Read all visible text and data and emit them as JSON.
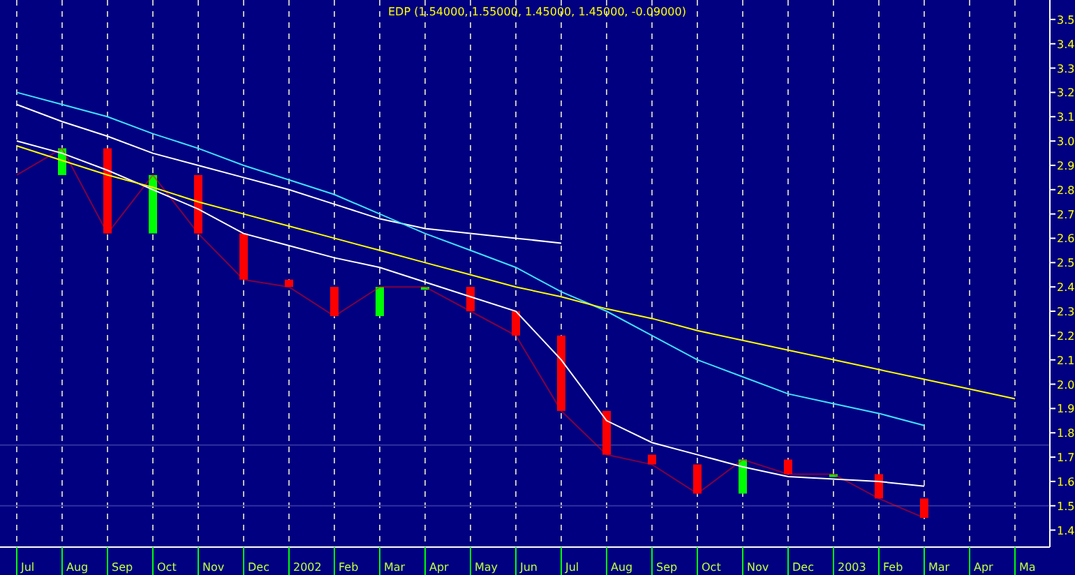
{
  "chart": {
    "chart_data": {
      "type": "line",
      "title": "EDP (1.54000, 1.55000, 1.45000, 1.45000, -0.09000)",
      "categories": [
        "Jul",
        "Aug",
        "Sep",
        "Oct",
        "Nov",
        "Dec",
        "2002",
        "Feb",
        "Mar",
        "Apr",
        "May",
        "Jun",
        "Jul",
        "Aug",
        "Sep",
        "Oct",
        "Nov",
        "Dec",
        "2003",
        "Feb",
        "Mar",
        "Apr",
        "Ma"
      ],
      "ylim": [
        1.33,
        3.58
      ],
      "ref_lines": [
        {
          "axis": "y",
          "value": 1.5
        },
        {
          "axis": "y",
          "value": 1.75
        }
      ],
      "yticks": [
        1.4,
        1.5,
        1.6,
        1.7,
        1.8,
        1.9,
        {
          "value": 2,
          "label": "2.0"
        },
        2.1,
        2.2,
        2.3,
        2.4,
        2.5,
        2.6,
        2.7,
        2.8,
        2.9,
        {
          "value": 3,
          "label": "3.0"
        },
        3.1,
        3.2,
        3.3,
        3.4,
        3.5
      ],
      "series": [
        {
          "color": "#ff0000",
          "values": [
            2.86,
            2.97,
            2.62,
            2.86,
            2.62,
            2.43,
            2.4,
            2.28,
            2.4,
            2.4,
            2.3,
            2.2,
            1.89,
            1.71,
            1.67,
            1.55,
            1.69,
            1.63,
            1.63,
            1.53,
            1.45,
            null,
            null
          ]
        },
        {
          "color": "#ffffff",
          "values": [
            3.0,
            2.95,
            2.88,
            2.8,
            2.72,
            2.62,
            2.57,
            2.52,
            2.48,
            2.42,
            2.36,
            2.3,
            2.1,
            1.85,
            1.76,
            1.71,
            1.66,
            1.62,
            1.61,
            1.6,
            1.58,
            null,
            null
          ]
        },
        {
          "color": "#ffffff",
          "values": [
            3.15,
            3.08,
            3.02,
            2.95,
            2.9,
            2.85,
            2.8,
            2.74,
            2.68,
            2.64,
            2.62,
            2.6,
            2.58,
            null,
            null,
            null,
            null,
            null,
            null,
            null,
            null,
            null,
            null
          ]
        },
        {
          "color": "#40e0ff",
          "values": [
            3.2,
            3.15,
            3.1,
            3.03,
            2.97,
            2.9,
            2.84,
            2.78,
            2.7,
            2.62,
            2.55,
            2.48,
            2.38,
            2.3,
            2.2,
            2.1,
            2.03,
            1.96,
            1.92,
            1.88,
            1.83,
            null,
            null
          ]
        },
        {
          "color": "#ffff00",
          "values": [
            2.98,
            2.92,
            2.86,
            2.81,
            2.75,
            2.7,
            2.65,
            2.6,
            2.55,
            2.5,
            2.45,
            2.4,
            2.36,
            2.31,
            2.27,
            2.22,
            2.18,
            2.14,
            2.1,
            2.06,
            2.02,
            1.98,
            1.94
          ]
        }
      ]
    }
  }
}
